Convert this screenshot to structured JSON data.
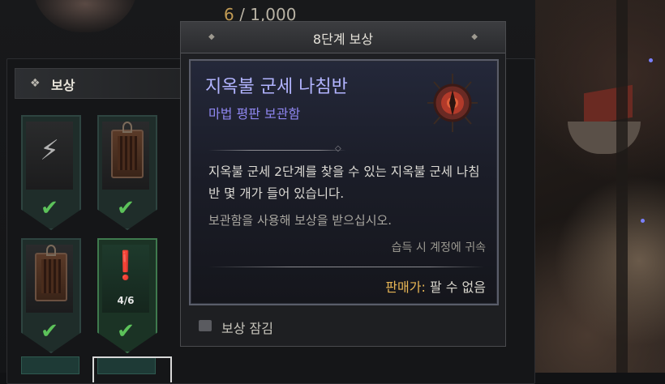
{
  "header": {
    "progress_current": "6",
    "progress_rest": " / 1,000"
  },
  "section": {
    "title": "보상"
  },
  "banners": [
    {
      "count": ""
    },
    {
      "count": ""
    },
    {
      "count": ""
    },
    {
      "count": "4/6"
    }
  ],
  "tooltip": {
    "header_title": "8단계 보상",
    "item_name": "지옥불 군세 나침반",
    "item_type": "마법 평판 보관함",
    "description": "지옥불 군세 2단계를 찾을 수 있는 지옥불 군세 나침반 몇 개가 들어 있습니다.",
    "hint": "보관함을 사용해 보상을 받으십시오.",
    "bind": "습득 시 계정에 귀속",
    "price_label": "판매가:",
    "price_value": " 팔 수 없음",
    "footer_label": "보상 잠김"
  },
  "colors": {
    "rarity_magic": "#b2b4ff",
    "accent_gold": "#e8b655",
    "check_green": "#5cc25a"
  }
}
